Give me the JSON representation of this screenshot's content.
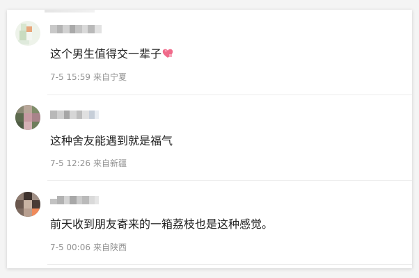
{
  "comments": [
    {
      "text": "这个男生值得交一辈子",
      "emoji": "heart-emoji",
      "date": "7-5 15:59",
      "location": "来自宁夏"
    },
    {
      "text": "这种舍友能遇到就是福气",
      "date": "7-5 12:26",
      "location": "来自新疆"
    },
    {
      "text": "前天收到朋友寄来的一箱荔枝也是这种感觉。",
      "date": "7-5 00:06",
      "location": "来自陕西"
    }
  ],
  "colors": {
    "comment_text": "#222222",
    "meta_text": "#939393",
    "divider": "#ececec",
    "heart": "#f06a8a"
  }
}
